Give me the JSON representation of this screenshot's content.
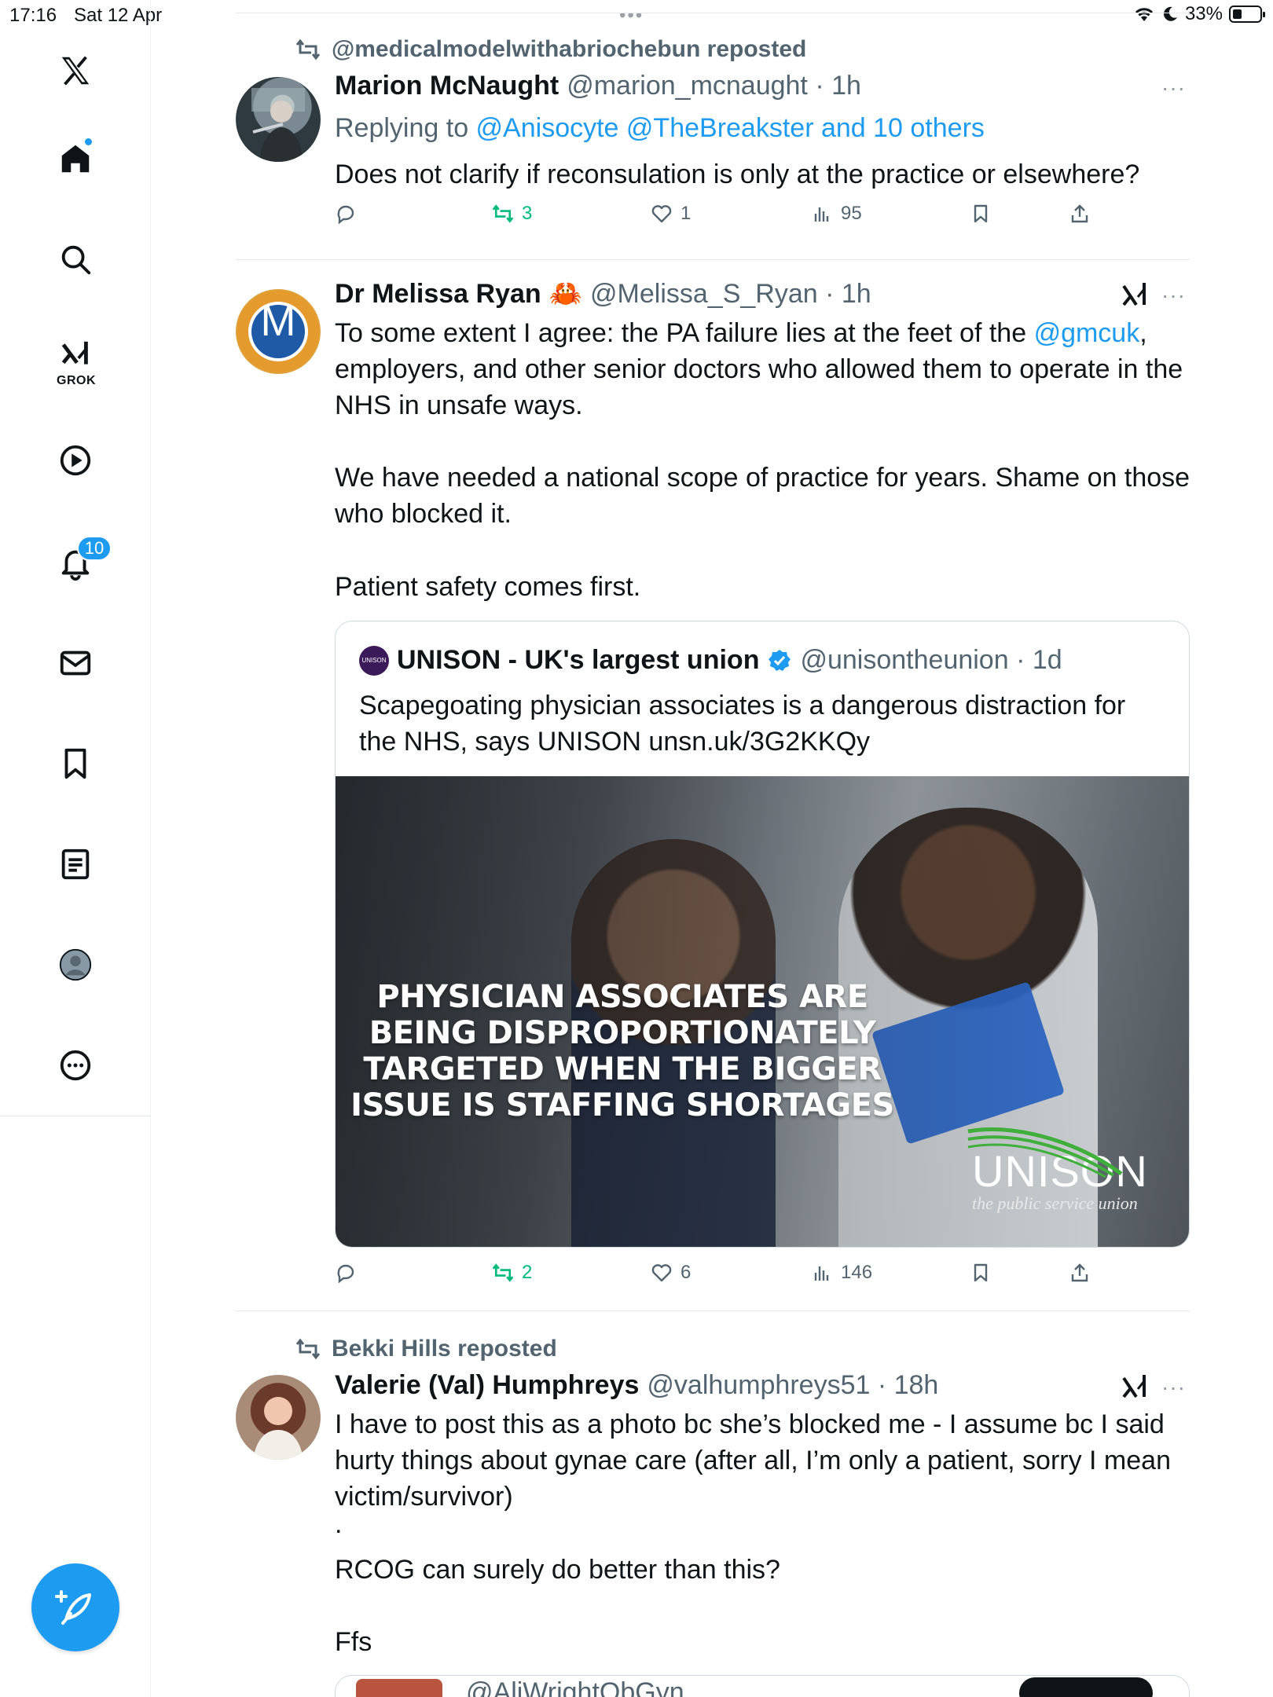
{
  "status_bar": {
    "time": "17:16",
    "date": "Sat 12 Apr",
    "battery": "33%",
    "multitask": "•••"
  },
  "sidebar": {
    "grok_label": "GROK",
    "notifications_badge": "10",
    "items": [
      "x-logo",
      "home",
      "explore",
      "grok",
      "video",
      "notifications",
      "messages",
      "bookmarks",
      "lists",
      "profile",
      "more"
    ]
  },
  "tweets": [
    {
      "repost": "@medicalmodelwithabriochebun reposted",
      "name": "Marion McNaught",
      "handle_time": "@marion_mcnaught · 1h",
      "reply_prefix": "Replying to ",
      "reply_to": "@Anisocyte @TheBreakster and 10 others",
      "text": "Does not clarify if reconsulation is only at the practice or elsewhere?",
      "stats": {
        "replies": "",
        "reposts": "3",
        "likes": "1",
        "views": "95"
      },
      "more": "···"
    },
    {
      "name": "Dr Melissa Ryan",
      "name_emoji": "🦀",
      "handle_time": "@Melissa_S_Ryan · 1h",
      "avatar_letter": "M",
      "text_line1_a": "To some extent I agree: the PA failure lies at the feet of the ",
      "text_link": "@gmcuk",
      "text_line1_b": ",",
      "text_rest": "employers, and other senior doctors who allowed them to operate in the NHS in unsafe ways.",
      "text_p2": "We have needed a national scope of practice for years. Shame on those who blocked it.",
      "text_p3": "Patient safety comes first.",
      "more": "···",
      "quote": {
        "name": "UNISON - UK's largest union",
        "handle_time": "@unisontheunion · 1d",
        "text": "Scapegoating physician associates is a dangerous distraction for the NHS, says UNISON unsn.uk/3G2KKQy",
        "logo_text": "UNISON",
        "image_headline_1": "PHYSICIAN ASSOCIATES ARE",
        "image_headline_2": "BEING DISPROPORTIONATELY",
        "image_headline_3": "TARGETED WHEN THE BIGGER",
        "image_headline_4": "ISSUE IS STAFFING SHORTAGES",
        "image_brand": "UNISON",
        "image_brand_tagline": "the public service union"
      },
      "stats": {
        "replies": "",
        "reposts": "2",
        "likes": "6",
        "views": "146"
      }
    },
    {
      "repost": "Bekki Hills reposted",
      "name": "Valerie (Val) Humphreys",
      "handle_time": "@valhumphreys51 · 18h",
      "text_p1": "I have to post this as a photo bc she’s blocked me - I assume bc I said hurty things about gynae care (after all, I’m only a patient, sorry I mean victim/survivor)",
      "text_dot": ".",
      "text_p2": "RCOG can surely do better than this?",
      "text_p3": "Ffs",
      "more": "···",
      "quote_preview": "@AliWrightObGyn"
    }
  ],
  "colors": {
    "accent": "#1d9bf0",
    "repost_green": "#00ba7c",
    "muted": "#536471"
  }
}
